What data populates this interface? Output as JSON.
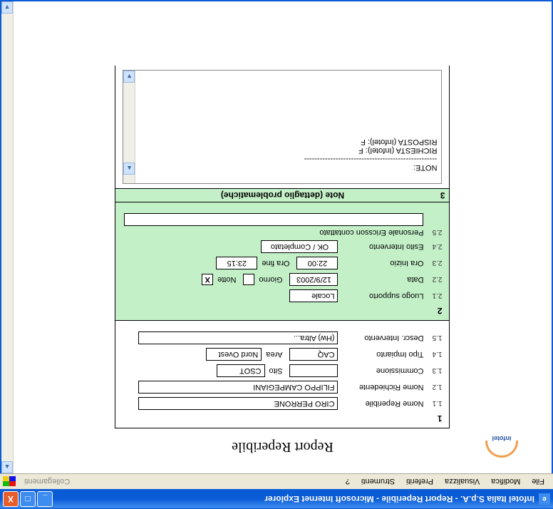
{
  "window": {
    "title": "Infotel Italia S.p.A. - Report Reperibile - Microsoft Internet Explorer"
  },
  "menubar": {
    "items": [
      "File",
      "Modifica",
      "Visualizza",
      "Preferiti",
      "Strumenti",
      "?"
    ],
    "links_label": "Collegamenti"
  },
  "logo_text": "infotel",
  "page_title": "Report Reperibile",
  "section1": {
    "num": "1",
    "rows": {
      "r11_num": "1.1",
      "r11_lbl": "Nome Reperibile",
      "r11_val": "CIRO PERRONE",
      "r12_num": "1.2",
      "r12_lbl": "Nome Richiedente",
      "r12_val": "FILIPPO CAMPEGIANI",
      "r13_num": "1.3",
      "r13_lbl": "Commissione",
      "r13_val": "",
      "r13_sito_lbl": "Sito",
      "r13_sito_val": "CSOT",
      "r14_num": "1.4",
      "r14_lbl": "Tipo Impianto",
      "r14_val": "CAQ",
      "r14_area_lbl": "Area",
      "r14_area_val": "Nord Ovest",
      "r15_num": "1.5",
      "r15_lbl": "Descr. Intervento",
      "r15_val": "(Hw) Altra..."
    }
  },
  "section2": {
    "num": "2",
    "rows": {
      "r21_num": "2.1",
      "r21_lbl": "Luogo supporto",
      "r21_val": "Locale",
      "r22_num": "2.2",
      "r22_lbl": "Data",
      "r22_val": "12/9/2003",
      "r22_giorno_lbl": "Giorno",
      "r22_giorno_chk": "",
      "r22_notte_lbl": "Notte",
      "r22_notte_chk": "X",
      "r23_num": "2.3",
      "r23_lbl": "Ora Inizio",
      "r23_val": "22:00",
      "r23_fine_lbl": "Ora fine",
      "r23_fine_val": "23:15",
      "r24_num": "2.4",
      "r24_lbl": "Esito Intervento",
      "r24_val": "OK / Completato",
      "r25_num": "2.5",
      "r25_lbl": "Personale Ericsson contattato",
      "r25_val": ""
    }
  },
  "section3": {
    "num": "3",
    "title": "Note (dettaglio problematiche)",
    "notes": "NOTE:\n---------------------------------------------------\nRICHIESTA (Infotel): F\nRISPOSTA (Infotel): F"
  }
}
